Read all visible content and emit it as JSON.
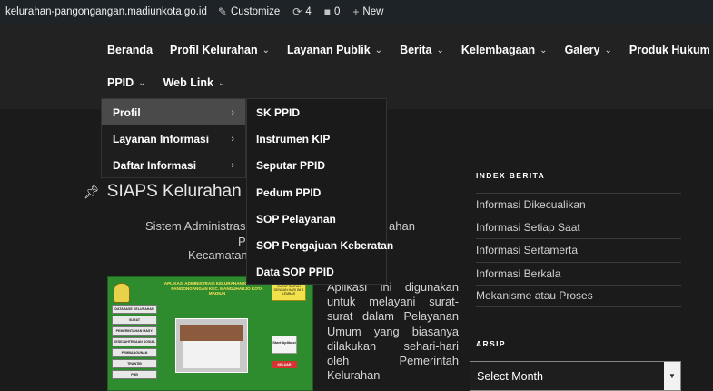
{
  "adminbar": {
    "site": "kelurahan-pangongangan.madiunkota.go.id",
    "customize": "Customize",
    "updates_count": "4",
    "comments_count": "0",
    "new_label": "New"
  },
  "nav": {
    "row1": [
      {
        "label": "Beranda",
        "has_caret": false
      },
      {
        "label": "Profil Kelurahan",
        "has_caret": true
      },
      {
        "label": "Layanan Publik",
        "has_caret": true
      },
      {
        "label": "Berita",
        "has_caret": true
      },
      {
        "label": "Kelembagaan",
        "has_caret": true
      },
      {
        "label": "Galery",
        "has_caret": true
      },
      {
        "label": "Produk Hukum",
        "has_caret": true
      }
    ],
    "row2": [
      {
        "label": "PPID",
        "has_caret": true
      },
      {
        "label": "Web Link",
        "has_caret": true
      }
    ]
  },
  "dropdown": {
    "level1": [
      "Profil",
      "Layanan Informasi",
      "Daftar Informasi"
    ],
    "level2": [
      "SK PPID",
      "Instrumen KIP",
      "Seputar PPID",
      "Pedum PPID",
      "SOP Pelayanan",
      "SOP Pengajuan Keberatan",
      "Data SOP PPID"
    ]
  },
  "article": {
    "title": "SIAPS Kelurahan",
    "line1": "Sistem Administrasi I",
    "line1_tail": "ahan",
    "line2": "P",
    "line3": "Kecamatan",
    "paragraph": "Aplikasi ini digunakan untuk melayani surat-surat dalam Pelayanan Umum yang biasanya dilakukan sehari-hari oleh Pemerintah Kelurahan"
  },
  "banner": {
    "header": "APLIKASI ADMINISTRASI KELURAHAN KELURAHAN PANGONGANGAN KEC. MANGUHARJO KOTA MADIUN",
    "surat_box": "SURAT SIMPAN DENGAN HARI INI 3 LEMBAR",
    "side_items": [
      "DATABASE KELURAHAN",
      "SURAT",
      "PEMERINTAHAN MASY.",
      "KESEJAHTERAAN SOSIAL",
      "PEMBANGUNAN",
      "TRANTIB",
      "PBB"
    ],
    "start": "Start Aplikasi",
    "keluar": "KELUAR"
  },
  "sidebar": {
    "index_heading": "INDEX BERITA",
    "index_items": [
      "Informasi Dikecualikan",
      "Informasi Setiap Saat",
      "Informasi Sertamerta",
      "Informasi Berkala",
      "Mekanisme atau Proses"
    ],
    "arsip_heading": "ARSIP",
    "select_value": "Select Month"
  }
}
